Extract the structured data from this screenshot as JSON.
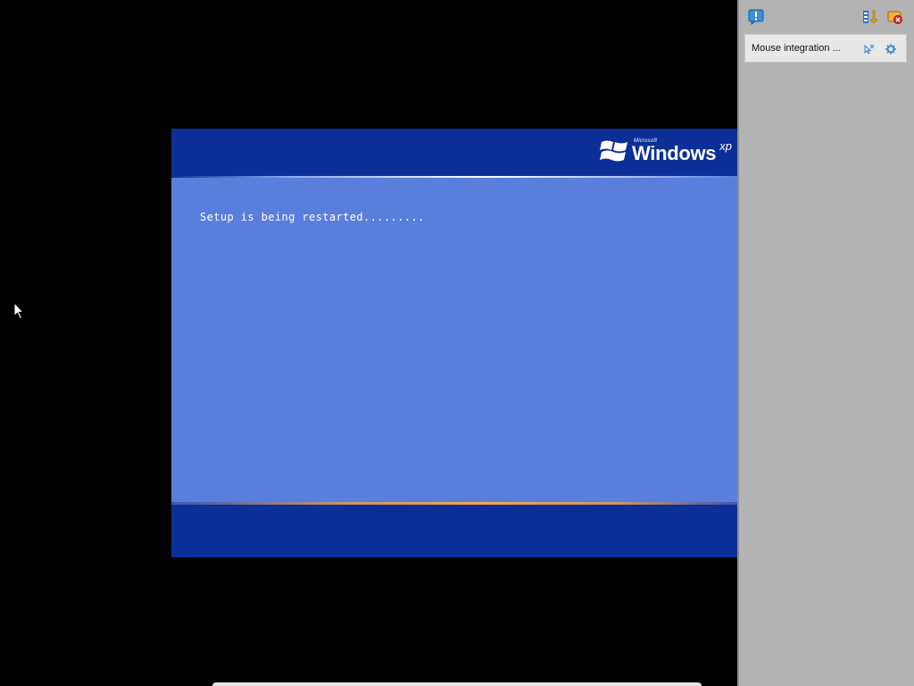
{
  "vm": {
    "logo": {
      "microsoft": "Microsoft",
      "windows": "Windows",
      "xp": "xp"
    },
    "status_text": "Setup is being restarted........."
  },
  "side_panel": {
    "notification": {
      "label": "Mouse integration ..."
    }
  },
  "colors": {
    "xp_band": "#0b2f96",
    "xp_body": "#5a7edc",
    "panel_bg": "#b3b3b3"
  },
  "icons": {
    "toolbar_left": "message-info-icon",
    "toolbar_right_1": "columns-arrow-icon",
    "toolbar_right_2": "close-notifications-icon",
    "notify_1": "mouse-integration-icon",
    "notify_2": "settings-icon"
  }
}
